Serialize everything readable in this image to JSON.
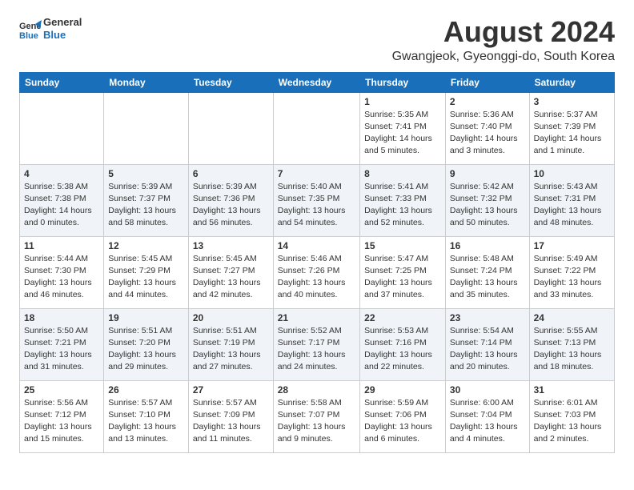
{
  "header": {
    "logo_line1": "General",
    "logo_line2": "Blue",
    "title": "August 2024",
    "subtitle": "Gwangjeok, Gyeonggi-do, South Korea"
  },
  "columns": [
    "Sunday",
    "Monday",
    "Tuesday",
    "Wednesday",
    "Thursday",
    "Friday",
    "Saturday"
  ],
  "weeks": [
    [
      {
        "day": "",
        "info": ""
      },
      {
        "day": "",
        "info": ""
      },
      {
        "day": "",
        "info": ""
      },
      {
        "day": "",
        "info": ""
      },
      {
        "day": "1",
        "info": "Sunrise: 5:35 AM\nSunset: 7:41 PM\nDaylight: 14 hours\nand 5 minutes."
      },
      {
        "day": "2",
        "info": "Sunrise: 5:36 AM\nSunset: 7:40 PM\nDaylight: 14 hours\nand 3 minutes."
      },
      {
        "day": "3",
        "info": "Sunrise: 5:37 AM\nSunset: 7:39 PM\nDaylight: 14 hours\nand 1 minute."
      }
    ],
    [
      {
        "day": "4",
        "info": "Sunrise: 5:38 AM\nSunset: 7:38 PM\nDaylight: 14 hours\nand 0 minutes."
      },
      {
        "day": "5",
        "info": "Sunrise: 5:39 AM\nSunset: 7:37 PM\nDaylight: 13 hours\nand 58 minutes."
      },
      {
        "day": "6",
        "info": "Sunrise: 5:39 AM\nSunset: 7:36 PM\nDaylight: 13 hours\nand 56 minutes."
      },
      {
        "day": "7",
        "info": "Sunrise: 5:40 AM\nSunset: 7:35 PM\nDaylight: 13 hours\nand 54 minutes."
      },
      {
        "day": "8",
        "info": "Sunrise: 5:41 AM\nSunset: 7:33 PM\nDaylight: 13 hours\nand 52 minutes."
      },
      {
        "day": "9",
        "info": "Sunrise: 5:42 AM\nSunset: 7:32 PM\nDaylight: 13 hours\nand 50 minutes."
      },
      {
        "day": "10",
        "info": "Sunrise: 5:43 AM\nSunset: 7:31 PM\nDaylight: 13 hours\nand 48 minutes."
      }
    ],
    [
      {
        "day": "11",
        "info": "Sunrise: 5:44 AM\nSunset: 7:30 PM\nDaylight: 13 hours\nand 46 minutes."
      },
      {
        "day": "12",
        "info": "Sunrise: 5:45 AM\nSunset: 7:29 PM\nDaylight: 13 hours\nand 44 minutes."
      },
      {
        "day": "13",
        "info": "Sunrise: 5:45 AM\nSunset: 7:27 PM\nDaylight: 13 hours\nand 42 minutes."
      },
      {
        "day": "14",
        "info": "Sunrise: 5:46 AM\nSunset: 7:26 PM\nDaylight: 13 hours\nand 40 minutes."
      },
      {
        "day": "15",
        "info": "Sunrise: 5:47 AM\nSunset: 7:25 PM\nDaylight: 13 hours\nand 37 minutes."
      },
      {
        "day": "16",
        "info": "Sunrise: 5:48 AM\nSunset: 7:24 PM\nDaylight: 13 hours\nand 35 minutes."
      },
      {
        "day": "17",
        "info": "Sunrise: 5:49 AM\nSunset: 7:22 PM\nDaylight: 13 hours\nand 33 minutes."
      }
    ],
    [
      {
        "day": "18",
        "info": "Sunrise: 5:50 AM\nSunset: 7:21 PM\nDaylight: 13 hours\nand 31 minutes."
      },
      {
        "day": "19",
        "info": "Sunrise: 5:51 AM\nSunset: 7:20 PM\nDaylight: 13 hours\nand 29 minutes."
      },
      {
        "day": "20",
        "info": "Sunrise: 5:51 AM\nSunset: 7:19 PM\nDaylight: 13 hours\nand 27 minutes."
      },
      {
        "day": "21",
        "info": "Sunrise: 5:52 AM\nSunset: 7:17 PM\nDaylight: 13 hours\nand 24 minutes."
      },
      {
        "day": "22",
        "info": "Sunrise: 5:53 AM\nSunset: 7:16 PM\nDaylight: 13 hours\nand 22 minutes."
      },
      {
        "day": "23",
        "info": "Sunrise: 5:54 AM\nSunset: 7:14 PM\nDaylight: 13 hours\nand 20 minutes."
      },
      {
        "day": "24",
        "info": "Sunrise: 5:55 AM\nSunset: 7:13 PM\nDaylight: 13 hours\nand 18 minutes."
      }
    ],
    [
      {
        "day": "25",
        "info": "Sunrise: 5:56 AM\nSunset: 7:12 PM\nDaylight: 13 hours\nand 15 minutes."
      },
      {
        "day": "26",
        "info": "Sunrise: 5:57 AM\nSunset: 7:10 PM\nDaylight: 13 hours\nand 13 minutes."
      },
      {
        "day": "27",
        "info": "Sunrise: 5:57 AM\nSunset: 7:09 PM\nDaylight: 13 hours\nand 11 minutes."
      },
      {
        "day": "28",
        "info": "Sunrise: 5:58 AM\nSunset: 7:07 PM\nDaylight: 13 hours\nand 9 minutes."
      },
      {
        "day": "29",
        "info": "Sunrise: 5:59 AM\nSunset: 7:06 PM\nDaylight: 13 hours\nand 6 minutes."
      },
      {
        "day": "30",
        "info": "Sunrise: 6:00 AM\nSunset: 7:04 PM\nDaylight: 13 hours\nand 4 minutes."
      },
      {
        "day": "31",
        "info": "Sunrise: 6:01 AM\nSunset: 7:03 PM\nDaylight: 13 hours\nand 2 minutes."
      }
    ]
  ]
}
